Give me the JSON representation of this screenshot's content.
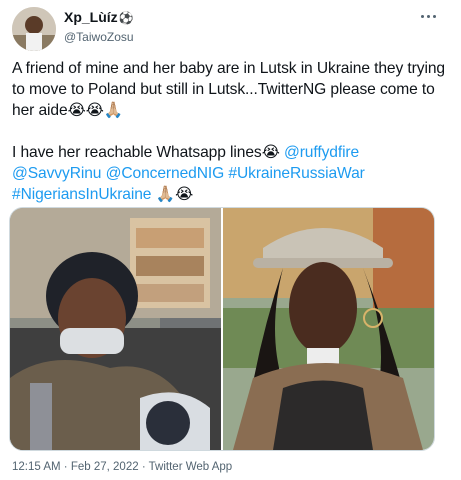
{
  "author": {
    "display_name": "Xp_Lùíz",
    "handle": "@TaiwoZosu",
    "badge_emoji": "⚽",
    "more_icon": "more-horizontal-icon"
  },
  "tweet": {
    "line1": "A friend of mine and her baby are in Lutsk in Ukraine they trying to move to Poland but still in Lutsk...TwitterNG please come to her aide😭😭🙏🏼",
    "line2_text": "I have her reachable Whatsapp lines😭 ",
    "mentions": [
      "@ruffydfire",
      "@SavvyRinu",
      "@ConcernedNIG"
    ],
    "hashtags": [
      "#UkraineRussiaWar",
      "#NigeriansInUkraine"
    ],
    "end_emoji": " 🙏🏼😭"
  },
  "media": {
    "count": 2,
    "link_color": "#1d9bf0"
  },
  "footer": {
    "time": "12:15 AM",
    "separator": "·",
    "date": "Feb 27, 2022",
    "app": "Twitter Web App"
  }
}
